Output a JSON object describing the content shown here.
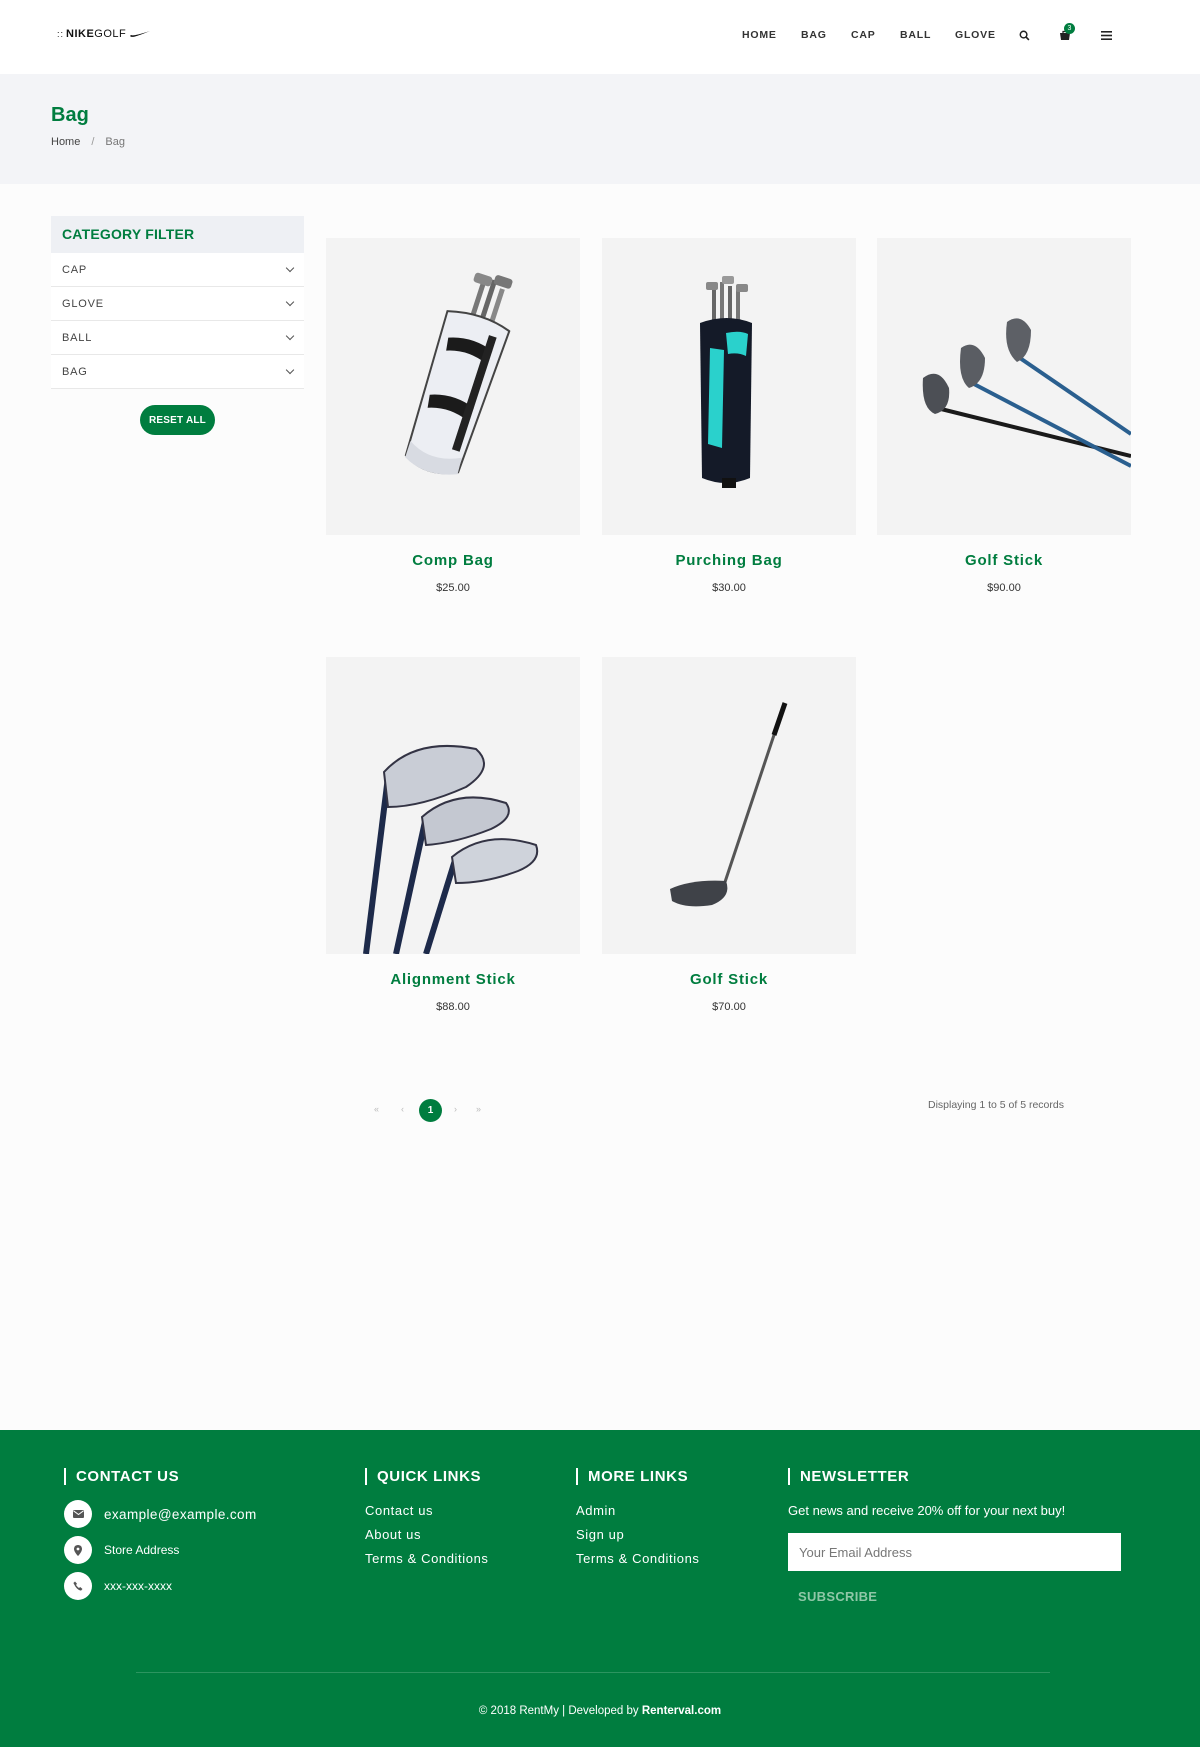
{
  "header": {
    "logo_prefix": "::",
    "logo_brand": "NIKE",
    "logo_suffix": "GOLF",
    "nav": [
      "HOME",
      "BAG",
      "CAP",
      "BALL",
      "GLOVE"
    ],
    "cart_count": "3"
  },
  "banner": {
    "title": "Bag",
    "breadcrumb": [
      "Home",
      "Bag"
    ],
    "breadcrumb_sep": "/"
  },
  "filter": {
    "title": "CATEGORY FILTER",
    "items": [
      "CAP",
      "GLOVE",
      "BALL",
      "BAG"
    ],
    "reset_label": "RESET ALL"
  },
  "products": [
    {
      "name": "Comp Bag",
      "price": "$25.00"
    },
    {
      "name": "Purching Bag",
      "price": "$30.00"
    },
    {
      "name": "Golf Stick",
      "price": "$90.00"
    },
    {
      "name": "Alignment Stick",
      "price": "$88.00"
    },
    {
      "name": "Golf Stick",
      "price": "$70.00"
    }
  ],
  "pagination": {
    "first": "«",
    "prev": "‹",
    "current": "1",
    "next": "›",
    "last": "»",
    "records": "Displaying 1 to 5 of 5 records"
  },
  "footer": {
    "contact": {
      "title": "CONTACT US",
      "email": "example@example.com",
      "address": "Store Address",
      "phone": "xxx-xxx-xxxx"
    },
    "quick_links": {
      "title": "QUICK LINKS",
      "items": [
        "Contact us",
        "About us",
        "Terms & Conditions"
      ]
    },
    "more_links": {
      "title": "MORE LINKS",
      "items": [
        "Admin",
        "Sign up",
        "Terms & Conditions"
      ]
    },
    "newsletter": {
      "title": "NEWSLETTER",
      "text": "Get news and receive 20% off for your next buy!",
      "placeholder": "Your Email Address",
      "button": "SUBSCRIBE"
    },
    "copyright_prefix": "© 2018 RentMy | Developed by ",
    "copyright_brand": "Renterval.com"
  },
  "colors": {
    "brand_green": "#007d3f",
    "banner_bg": "#f3f4f7",
    "footer_bg": "#007d3f"
  }
}
